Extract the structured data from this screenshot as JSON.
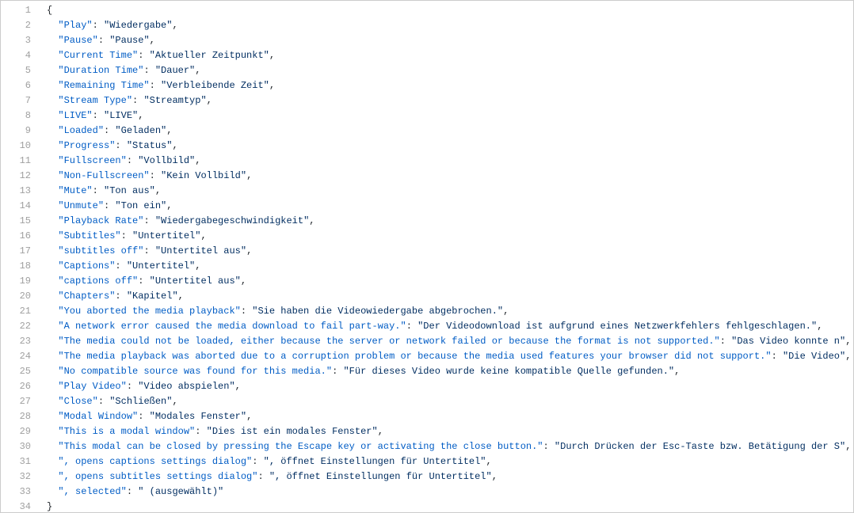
{
  "code": {
    "entries": [
      {
        "k": "Play",
        "v": "Wiedergabe"
      },
      {
        "k": "Pause",
        "v": "Pause"
      },
      {
        "k": "Current Time",
        "v": "Aktueller Zeitpunkt"
      },
      {
        "k": "Duration Time",
        "v": "Dauer"
      },
      {
        "k": "Remaining Time",
        "v": "Verbleibende Zeit"
      },
      {
        "k": "Stream Type",
        "v": "Streamtyp"
      },
      {
        "k": "LIVE",
        "v": "LIVE"
      },
      {
        "k": "Loaded",
        "v": "Geladen"
      },
      {
        "k": "Progress",
        "v": "Status"
      },
      {
        "k": "Fullscreen",
        "v": "Vollbild"
      },
      {
        "k": "Non-Fullscreen",
        "v": "Kein Vollbild"
      },
      {
        "k": "Mute",
        "v": "Ton aus"
      },
      {
        "k": "Unmute",
        "v": "Ton ein"
      },
      {
        "k": "Playback Rate",
        "v": "Wiedergabegeschwindigkeit"
      },
      {
        "k": "Subtitles",
        "v": "Untertitel"
      },
      {
        "k": "subtitles off",
        "v": "Untertitel aus"
      },
      {
        "k": "Captions",
        "v": "Untertitel"
      },
      {
        "k": "captions off",
        "v": "Untertitel aus"
      },
      {
        "k": "Chapters",
        "v": "Kapitel"
      },
      {
        "k": "You aborted the media playback",
        "v": "Sie haben die Videowiedergabe abgebrochen."
      },
      {
        "k": "A network error caused the media download to fail part-way.",
        "v": "Der Videodownload ist aufgrund eines Netzwerkfehlers fehlgeschlagen."
      },
      {
        "k": "The media could not be loaded, either because the server or network failed or because the format is not supported.",
        "v": "Das Video konnte n"
      },
      {
        "k": "The media playback was aborted due to a corruption problem or because the media used features your browser did not support.",
        "v": "Die Video"
      },
      {
        "k": "No compatible source was found for this media.",
        "v": "Für dieses Video wurde keine kompatible Quelle gefunden."
      },
      {
        "k": "Play Video",
        "v": "Video abspielen"
      },
      {
        "k": "Close",
        "v": "Schließen"
      },
      {
        "k": "Modal Window",
        "v": "Modales Fenster"
      },
      {
        "k": "This is a modal window",
        "v": "Dies ist ein modales Fenster"
      },
      {
        "k": "This modal can be closed by pressing the Escape key or activating the close button.",
        "v": "Durch Drücken der Esc-Taste bzw. Betätigung der S"
      },
      {
        "k": ", opens captions settings dialog",
        "v": ", öffnet Einstellungen für Untertitel"
      },
      {
        "k": ", opens subtitles settings dialog",
        "v": ", öffnet Einstellungen für Untertitel"
      },
      {
        "k": ", selected",
        "v": " (ausgewählt)",
        "last": true
      }
    ],
    "open_brace": "{",
    "close_brace": "}"
  }
}
